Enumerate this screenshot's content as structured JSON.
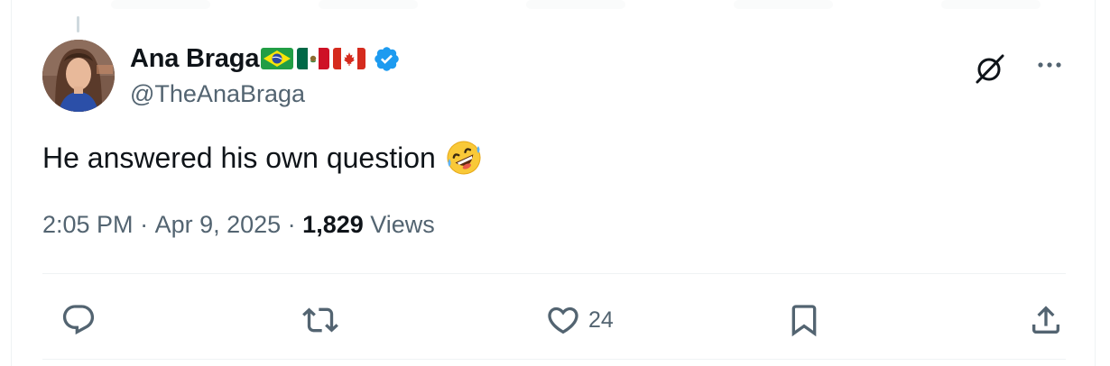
{
  "author": {
    "display_name": "Ana Braga",
    "flags": [
      "brazil-flag",
      "mexico-flag",
      "canada-flag"
    ],
    "verified": true,
    "handle": "@TheAnaBraga"
  },
  "post": {
    "text": "He answered his own question",
    "emoji": "rolling-on-floor-laughing-emoji",
    "time": "2:05 PM",
    "separator": " · ",
    "date": "Apr 9, 2025",
    "views_count": "1,829",
    "views_label": " Views"
  },
  "actions": {
    "reply": {
      "icon": "reply-icon",
      "count": ""
    },
    "repost": {
      "icon": "repost-icon",
      "count": ""
    },
    "like": {
      "icon": "heart-icon",
      "count": "24"
    },
    "bookmark": {
      "icon": "bookmark-icon",
      "count": ""
    },
    "share": {
      "icon": "share-icon",
      "count": ""
    }
  },
  "header_icons": [
    "grok-icon",
    "more-icon"
  ],
  "colors": {
    "text_primary": "#0f1419",
    "text_secondary": "#536471",
    "verified_blue": "#1d9bf0",
    "divider": "#eff3f4"
  }
}
